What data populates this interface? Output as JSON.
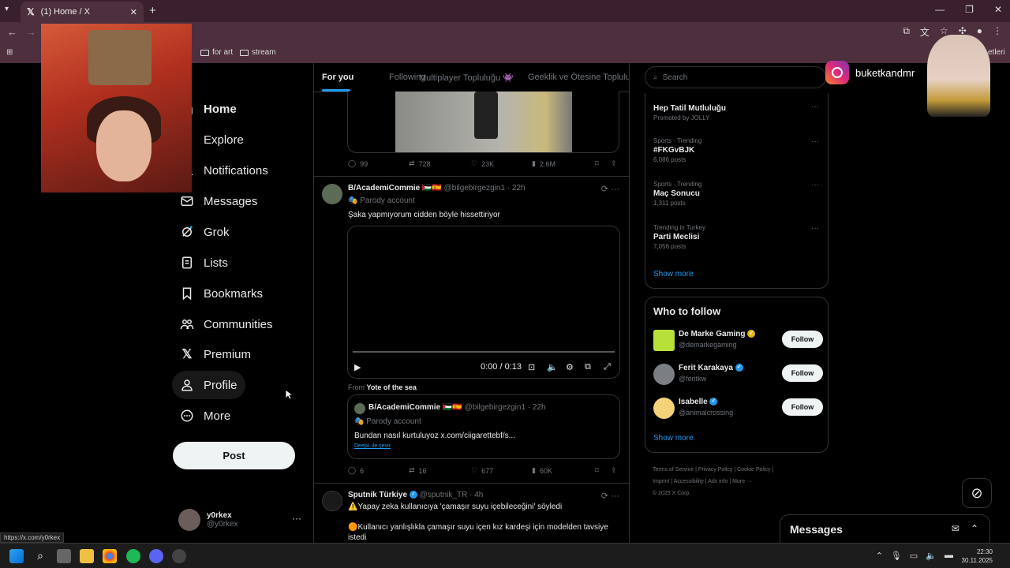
{
  "browser": {
    "tab_title": "(1) Home / X",
    "bookmarks": [
      "for art",
      "stream"
    ],
    "bookmark_partial_right": "etleri",
    "status_url": "https://x.com/y0rkex"
  },
  "nav": {
    "items": [
      {
        "label": "Home",
        "icon": "home-icon"
      },
      {
        "label": "Explore",
        "icon": "search-icon"
      },
      {
        "label": "Notifications",
        "icon": "bell-icon"
      },
      {
        "label": "Messages",
        "icon": "mail-icon"
      },
      {
        "label": "Grok",
        "icon": "grok-icon"
      },
      {
        "label": "Lists",
        "icon": "list-icon"
      },
      {
        "label": "Bookmarks",
        "icon": "bookmark-icon"
      },
      {
        "label": "Communities",
        "icon": "people-icon"
      },
      {
        "label": "Premium",
        "icon": "x-logo-icon"
      },
      {
        "label": "Profile",
        "icon": "person-icon"
      },
      {
        "label": "More",
        "icon": "more-circle-icon"
      }
    ],
    "post_label": "Post",
    "account": {
      "name": "y0rkex",
      "handle": "@y0rkex"
    }
  },
  "feed": {
    "tabs": [
      "For you",
      "Following",
      "Multiplayer Topluluğu 👾",
      "Geeklik ve Ötesine Topluluğ"
    ],
    "first_tweet_actions": {
      "replies": "99",
      "reposts": "728",
      "likes": "23K",
      "views": "2.6M"
    },
    "tweet2": {
      "name": "B/AcademiCommie",
      "flags": "🇵🇸🇪🇸",
      "handle": "@bilgebirgezgin1",
      "time": "· 22h",
      "parody": "Parody account",
      "text": "Şaka yapmıyorum cidden böyle hissettiriyor",
      "video_time": "0:00 / 0:13",
      "from_prefix": "From",
      "from_source": "Yote of the sea",
      "quote": {
        "name": "B/AcademiCommie",
        "flags": "🇵🇸🇪🇸",
        "handle": "@bilgebirgezgin1",
        "time": "· 22h",
        "parody": "Parody account",
        "text": "Bundan nasıl kurtuluyoz x.com/ciigarettebf/s...",
        "translate": "DeepL ile çevir"
      },
      "actions": {
        "replies": "6",
        "reposts": "16",
        "likes": "677",
        "views": "60K"
      }
    },
    "tweet3": {
      "name": "Sputnik Türkiye",
      "handle": "@sputnik_TR",
      "time": "· 4h",
      "line1": "⚠️Yapay zeka kullanıcıya 'çamaşır suyu içebileceğini' söyledi",
      "line2": "🟠Kullanıcı yanlışlıkla çamaşır suyu içen kız kardeşi için modelden tavsiye istedi"
    }
  },
  "right": {
    "search_placeholder": "Search",
    "trends": [
      {
        "meta": "",
        "name": "Hep Tatil Mutluluğu",
        "posts": "Promoted by JOLLY"
      },
      {
        "meta": "Sports · Trending",
        "name": "#FKGvBJK",
        "posts": "6,086 posts"
      },
      {
        "meta": "Sports · Trending",
        "name": "Maç Sonucu",
        "posts": "1,311 posts"
      },
      {
        "meta": "Trending in Turkey",
        "name": "Parti Meclisi",
        "posts": "7,056 posts"
      }
    ],
    "show_more": "Show more",
    "who_to_follow_title": "Who to follow",
    "follow": [
      {
        "name": "De Marke Gaming",
        "handle": "@demarkegaming",
        "btn": "Follow"
      },
      {
        "name": "Ferit Karakaya",
        "handle": "@feritkw",
        "btn": "Follow"
      },
      {
        "name": "Isabelle",
        "handle": "@animalcrossing",
        "btn": "Follow"
      }
    ],
    "footer": {
      "line1": "Terms of Service  |  Privacy Policy  |  Cookie Policy  |",
      "line2": "Imprint  |  Accessibility  |  Ads info  |  More ···",
      "line3": "© 2025 X Corp."
    }
  },
  "overlay": {
    "instagram_name": "buketkandmr"
  },
  "messages_drawer": {
    "title": "Messages"
  },
  "taskbar": {
    "time": "22:30",
    "date": "30.11.2025"
  },
  "colors": {
    "accent": "#1d9bf0",
    "background": "#000000",
    "chrome": "#4d2f3d"
  }
}
